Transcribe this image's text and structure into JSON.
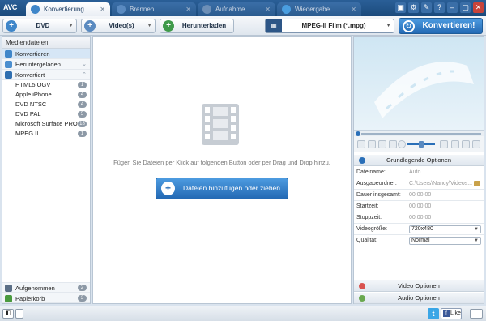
{
  "app": {
    "logo": "AVC"
  },
  "tabs": [
    {
      "label": "Konvertierung",
      "active": true
    },
    {
      "label": "Brennen",
      "active": false
    },
    {
      "label": "Aufnahme",
      "active": false
    },
    {
      "label": "Wiedergabe",
      "active": false
    }
  ],
  "window_buttons": [
    "▣",
    "⚙",
    "✎",
    "?",
    "–",
    "▢",
    "✕"
  ],
  "toolbar": {
    "dvd_label": "DVD",
    "videos_label": "Video(s)",
    "download_label": "Herunterladen",
    "format_label": "MPEG-II Film (*.mpg)",
    "convert_label": "Konvertieren!"
  },
  "sidebar": {
    "header": "Mediendateien",
    "sections": [
      {
        "label": "Konvertieren",
        "selected": true
      },
      {
        "label": "Heruntergeladen"
      },
      {
        "label": "Konvertiert"
      }
    ],
    "converted_items": [
      {
        "label": "HTML5 OGV",
        "count": "1"
      },
      {
        "label": "Apple iPhone",
        "count": "4"
      },
      {
        "label": "DVD NTSC",
        "count": "4"
      },
      {
        "label": "DVD PAL",
        "count": "5"
      },
      {
        "label": "Microsoft Surface PRO...",
        "count": "18"
      },
      {
        "label": "MPEG II",
        "count": "1"
      }
    ],
    "bottom": [
      {
        "label": "Aufgenommen",
        "count": "2"
      },
      {
        "label": "Papierkorb",
        "count": "3"
      }
    ]
  },
  "center": {
    "hint": "Fügen Sie Dateien per Klick auf folgenden Button oder per Drag und Drop hinzu.",
    "add_button": "Dateien hinzufügen oder ziehen"
  },
  "right": {
    "basic_options": "Grundlegende Optionen",
    "props": [
      {
        "key": "Dateiname:",
        "value": "Auto"
      },
      {
        "key": "Ausgabeordner:",
        "value": "C:\\Users\\Nancy\\Videos..."
      },
      {
        "key": "Dauer insgesamt:",
        "value": "00:00:00"
      },
      {
        "key": "Startzeit:",
        "value": "00:00:00"
      },
      {
        "key": "Stoppzeit:",
        "value": "00:00:00"
      },
      {
        "key": "Videogröße:",
        "value": "720x480"
      },
      {
        "key": "Qualität:",
        "value": "Normal"
      }
    ],
    "video_options": "Video Optionen",
    "audio_options": "Audio Optionen"
  },
  "status": {
    "like": "Like",
    "twitter": "t",
    "facebook": "f"
  },
  "colors": {
    "accent": "#2a6fb8",
    "tab_bar": "#1b4a7c",
    "close": "#c8433a"
  }
}
